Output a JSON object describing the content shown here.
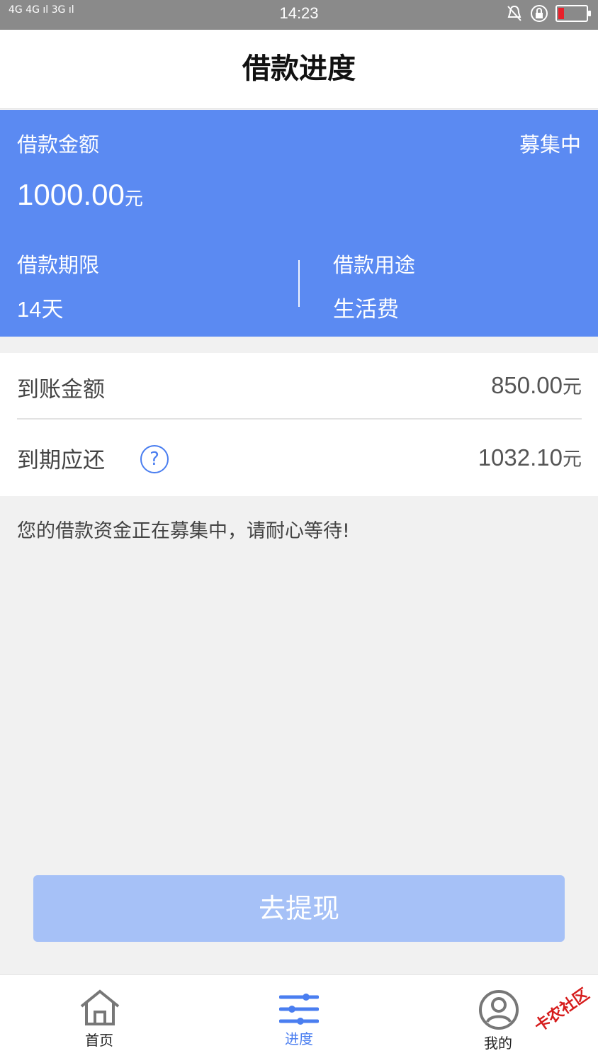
{
  "status_bar": {
    "signal": "4G 4G ıl 3G ıl",
    "time": "14:23",
    "battery_level": 0.2,
    "battery_color": "#e8202a"
  },
  "header": {
    "title": "借款进度"
  },
  "summary_card": {
    "amount_label": "借款金额",
    "status": "募集中",
    "amount": "1000.00",
    "amount_unit": "元",
    "term_label": "借款期限",
    "term_value": "14天",
    "purpose_label": "借款用途",
    "purpose_value": "生活费",
    "bg_color": "#5b8af2"
  },
  "details": {
    "received_label": "到账金额",
    "received_value": "850.00",
    "received_unit": "元",
    "due_label": "到期应还",
    "due_value": "1032.10",
    "due_unit": "元",
    "help_icon": "question-circle-icon"
  },
  "notice": "您的借款资金正在募集中，请耐心等待!",
  "cta": {
    "label": "去提现",
    "color": "#a6c1f7"
  },
  "tabbar": {
    "tabs": [
      {
        "label": "首页",
        "icon": "home-icon"
      },
      {
        "label": "进度",
        "icon": "sliders-icon",
        "active": true
      },
      {
        "label": "我的",
        "icon": "user-circle-icon"
      }
    ],
    "active_color": "#4a7ef0"
  },
  "watermark": "卡农社区"
}
